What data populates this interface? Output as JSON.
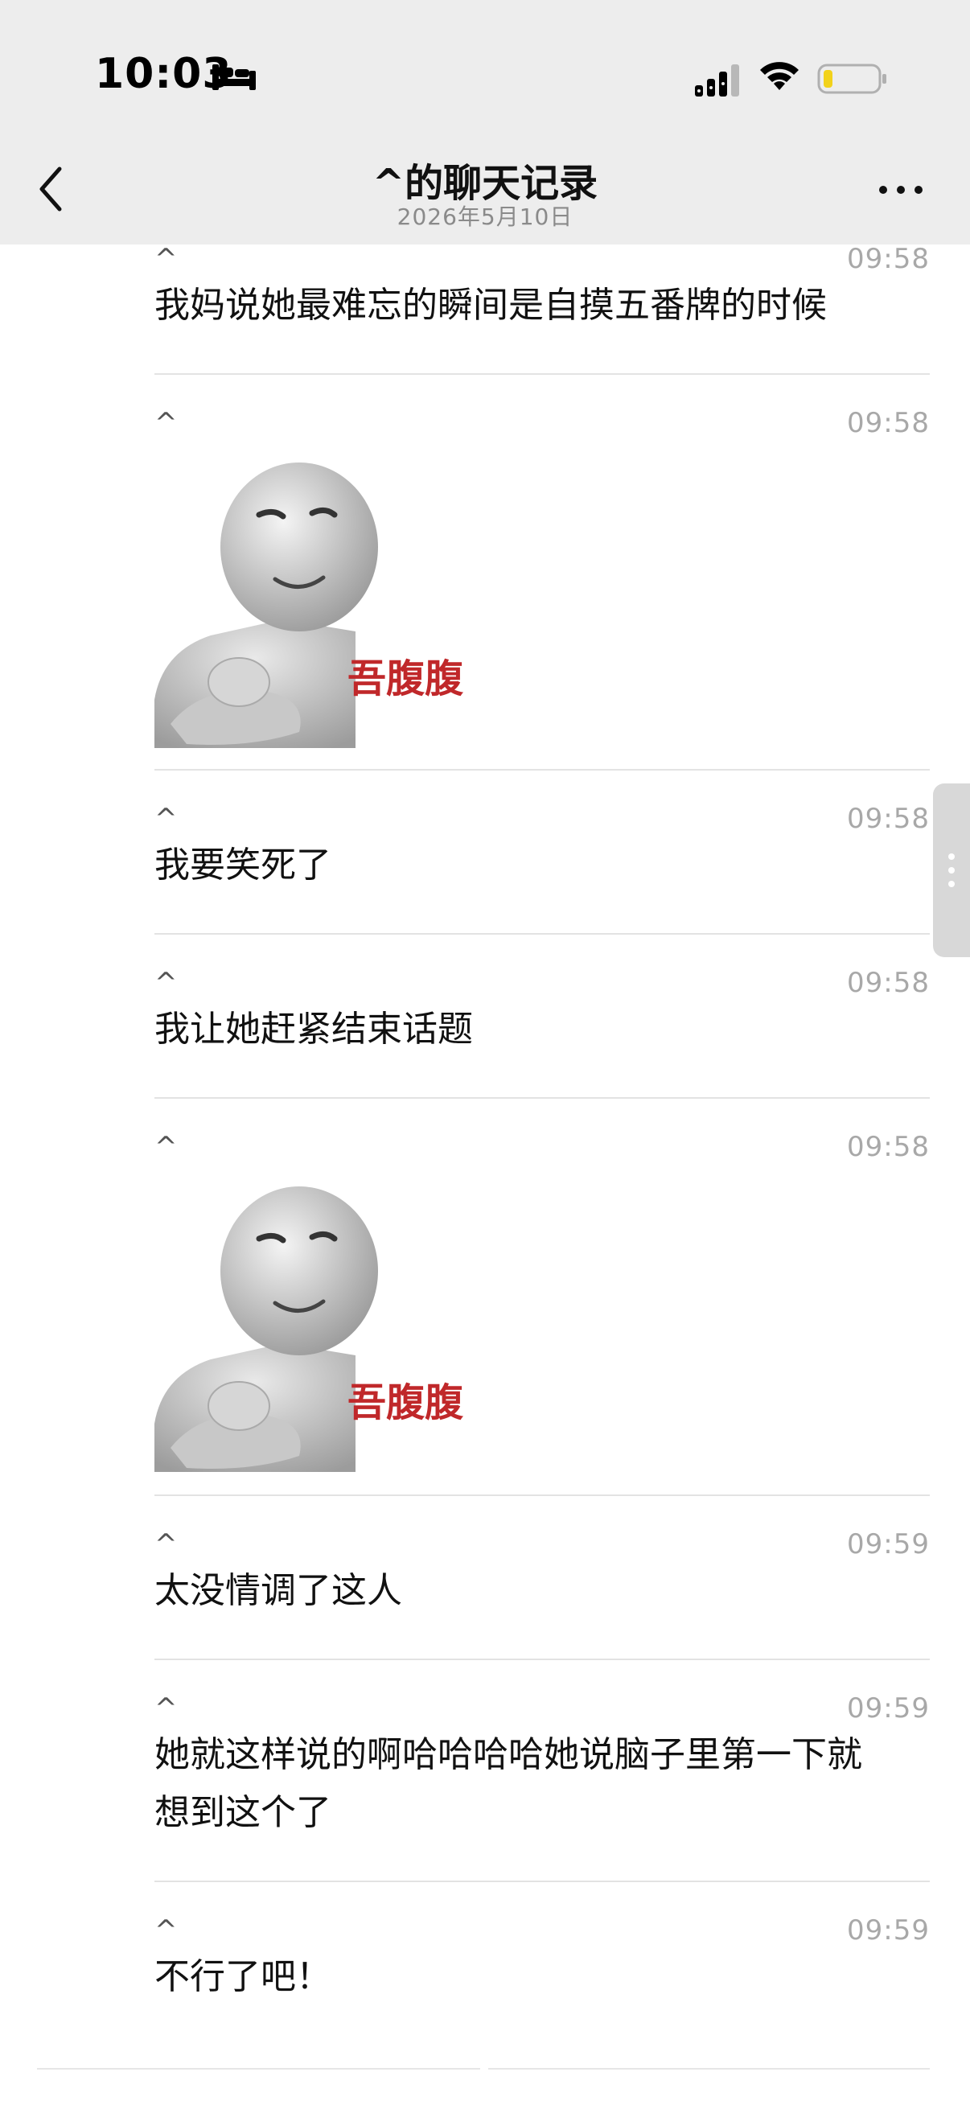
{
  "status_bar": {
    "time": "10:03",
    "icons": [
      "bed-icon",
      "signal-icon",
      "wifi-icon",
      "battery-icon"
    ]
  },
  "nav": {
    "title": "^的聊天记录",
    "subtitle": "2026年5月10日",
    "back_icon": "chevron-left-icon",
    "more_icon": "ellipsis-icon"
  },
  "messages": [
    {
      "type": "text",
      "sender": "^",
      "time": "09:58",
      "text": "我妈说她最难忘的瞬间是自摸五番牌的时候"
    },
    {
      "type": "sticker",
      "sender": "^",
      "time": "09:58",
      "sticker_caption": "吾腹腹"
    },
    {
      "type": "text",
      "sender": "^",
      "time": "09:58",
      "text": "我要笑死了"
    },
    {
      "type": "text",
      "sender": "^",
      "time": "09:58",
      "text": "我让她赶紧结束话题"
    },
    {
      "type": "sticker",
      "sender": "^",
      "time": "09:58",
      "sticker_caption": "吾腹腹"
    },
    {
      "type": "text",
      "sender": "^",
      "time": "09:59",
      "text": "太没情调了这人"
    },
    {
      "type": "text",
      "sender": "^",
      "time": "09:59",
      "text_lines": [
        "她就这样说的啊哈哈哈哈她说脑子里第一下就",
        "想到这个了"
      ]
    },
    {
      "type": "text",
      "sender": "^",
      "time": "09:59",
      "text": "不行了吧！"
    }
  ],
  "colors": {
    "header_bg": "#ededed",
    "sticker_caption": "#c0282a",
    "time_text": "#a8a8a8",
    "battery_fill": "#f2d21b"
  }
}
